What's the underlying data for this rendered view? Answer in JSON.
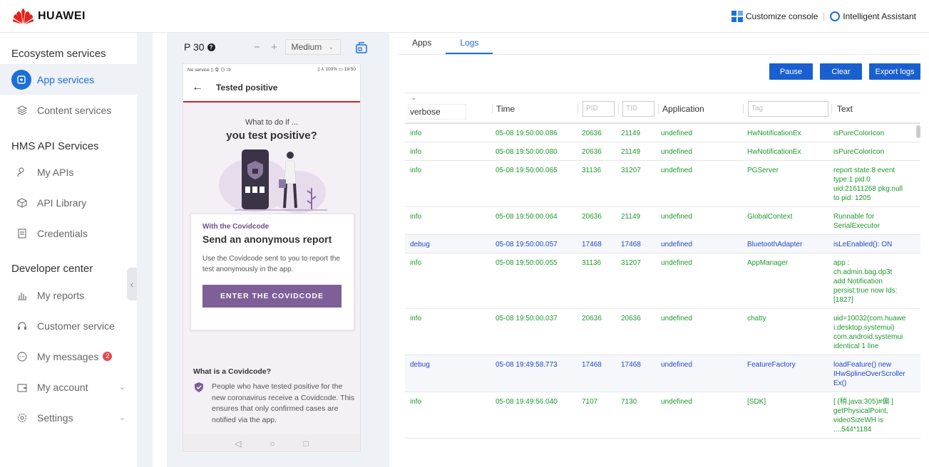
{
  "brand": {
    "name": "HUAWEI",
    "accent": "#1a6fd8",
    "logo_color": "#e2231a"
  },
  "topbar": {
    "customize": "Customize console",
    "assistant": "Intelligent Assistant"
  },
  "sidebar": {
    "groups": [
      "Ecosystem services",
      "HMS API Services",
      "Developer center"
    ],
    "items": [
      {
        "label": "App services",
        "icon": "app-services-icon",
        "active": true
      },
      {
        "label": "Content services",
        "icon": "layers-icon"
      },
      {
        "label": "My APIs",
        "icon": "user-api-icon"
      },
      {
        "label": "API Library",
        "icon": "cube-icon"
      },
      {
        "label": "Credentials",
        "icon": "document-icon"
      },
      {
        "label": "My reports",
        "icon": "bar-chart-icon"
      },
      {
        "label": "Customer service",
        "icon": "headset-icon"
      },
      {
        "label": "My messages",
        "icon": "chat-icon",
        "badge": "2"
      },
      {
        "label": "My account",
        "icon": "wallet-icon"
      },
      {
        "label": "Settings",
        "icon": "gear-icon"
      }
    ]
  },
  "device": {
    "name": "P 30",
    "help": "?",
    "minus": "−",
    "plus": "+",
    "size": "Medium"
  },
  "phone": {
    "status_left": "No service ▯ 令 ⊙ ⇒",
    "status_right": "▯ ⅄ 100% ▭ 19:50",
    "title": "Tested positive",
    "q1": "What to do if ...",
    "q2": "you test positive?",
    "card_kicker": "With the Covidcode",
    "card_title": "Send an anonymous report",
    "card_text": "Use the Covidcode sent to you to report the test anonymously in the app.",
    "card_button": "ENTER THE COVIDCODE",
    "what_title": "What is a Covidcode?",
    "what_text": "People who have tested positive for the new coronavirus receive a Covidcode. This ensures that only confirmed cases are notified via the app.",
    "nav_back": "◁",
    "nav_home": "○",
    "nav_recent": "□"
  },
  "tabs": [
    "Apps",
    "Logs"
  ],
  "active_tab": "Logs",
  "actions": {
    "pause": "Pause",
    "clear": "Clear",
    "export": "Export logs"
  },
  "log_header": {
    "level": "verbose",
    "time": "Time",
    "pid": "PID",
    "tid": "TID",
    "application": "Application",
    "tag": "Tag",
    "text": "Text"
  },
  "logs": [
    {
      "level": "info",
      "time": "05-08 19:50:00.086",
      "pid": "20636",
      "tid": "21149",
      "app": "undefined",
      "tag": "HwNotificationEx",
      "text": [
        "isPureColorIcon"
      ]
    },
    {
      "level": "info",
      "time": "05-08 19:50:00.080",
      "pid": "20636",
      "tid": "21149",
      "app": "undefined",
      "tag": "HwNotificationEx",
      "text": [
        "isPureColorIcon"
      ]
    },
    {
      "level": "info",
      "time": "05-08 19:50:00.065",
      "pid": "31136",
      "tid": "31207",
      "app": "undefined",
      "tag": "PGServer",
      "text": [
        "report state:8 event",
        "type:1 pid:0",
        "uid:21611268 pkg:null",
        "to pid: 1205"
      ]
    },
    {
      "level": "info",
      "time": "05-08 19:50:00.064",
      "pid": "20636",
      "tid": "21149",
      "app": "undefined",
      "tag": "GlobalContext",
      "text": [
        "Runnable for",
        "SerialExecutor"
      ]
    },
    {
      "level": "debug",
      "time": "05-08 19:50:00.057",
      "pid": "17468",
      "tid": "17468",
      "app": "undefined",
      "tag": "BluetoothAdapter",
      "text": [
        "isLeEnabled(): ON"
      ]
    },
    {
      "level": "info",
      "time": "05-08 19:50:00.055",
      "pid": "31136",
      "tid": "31207",
      "app": "undefined",
      "tag": "AppManager",
      "text": [
        "app :",
        "ch.admin.bag.dp3t",
        "add Notification",
        "persist:true now Ids:",
        "[1827]"
      ]
    },
    {
      "level": "info",
      "time": "05-08 19:50:00.037",
      "pid": "20636",
      "tid": "20636",
      "app": "undefined",
      "tag": "chatty",
      "text": [
        "uid=10032(com.huawe",
        "i.desktop.systemui)",
        "com.android.systemui",
        "identical 1 line"
      ]
    },
    {
      "level": "debug",
      "time": "05-08 19:49:58.773",
      "pid": "17468",
      "tid": "17468",
      "app": "undefined",
      "tag": "FeatureFactory",
      "text": [
        "loadFeature() new",
        "IHwSplineOverScroller",
        "Ex()"
      ]
    },
    {
      "level": "info",
      "time": "05-08 19:49:56.040",
      "pid": "7107",
      "tid": "7130",
      "app": "undefined",
      "tag": "[SDK]",
      "text": [
        "[ (稍.java:305)#偏 ]",
        "getPhysicalPoint,",
        "videoSizeWH is",
        "....544*1184"
      ]
    }
  ]
}
